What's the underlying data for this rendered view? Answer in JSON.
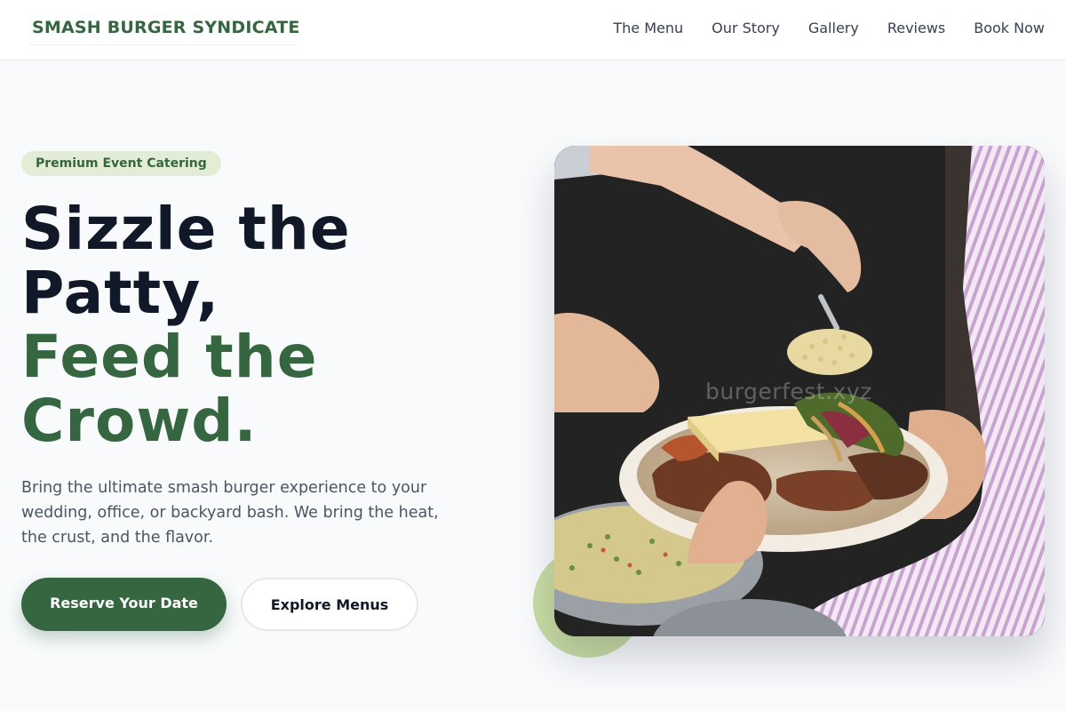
{
  "nav": {
    "brand": "SMASH BURGER SYNDICATE",
    "links": [
      "The Menu",
      "Our Story",
      "Gallery",
      "Reviews",
      "Book Now"
    ]
  },
  "hero": {
    "badge": "Premium Event Catering",
    "headline_lines": [
      "Sizzle the",
      "Patty,"
    ],
    "headline_accent_lines": [
      "Feed the",
      "Crowd."
    ],
    "description": "Bring the ultimate smash burger experience to your wedding, office, or backyard bash. We bring the heat, the crust, and the flavor.",
    "primary_cta": "Reserve Your Date",
    "secondary_cta": "Explore Menus"
  },
  "photo": {
    "watermark": "burgerfest.xyz"
  },
  "colors": {
    "brand_green": "#356640",
    "badge_bg": "#e3edd6",
    "blob": "#c8dca4",
    "text_dark": "#111827",
    "text_muted": "#4b5563"
  }
}
